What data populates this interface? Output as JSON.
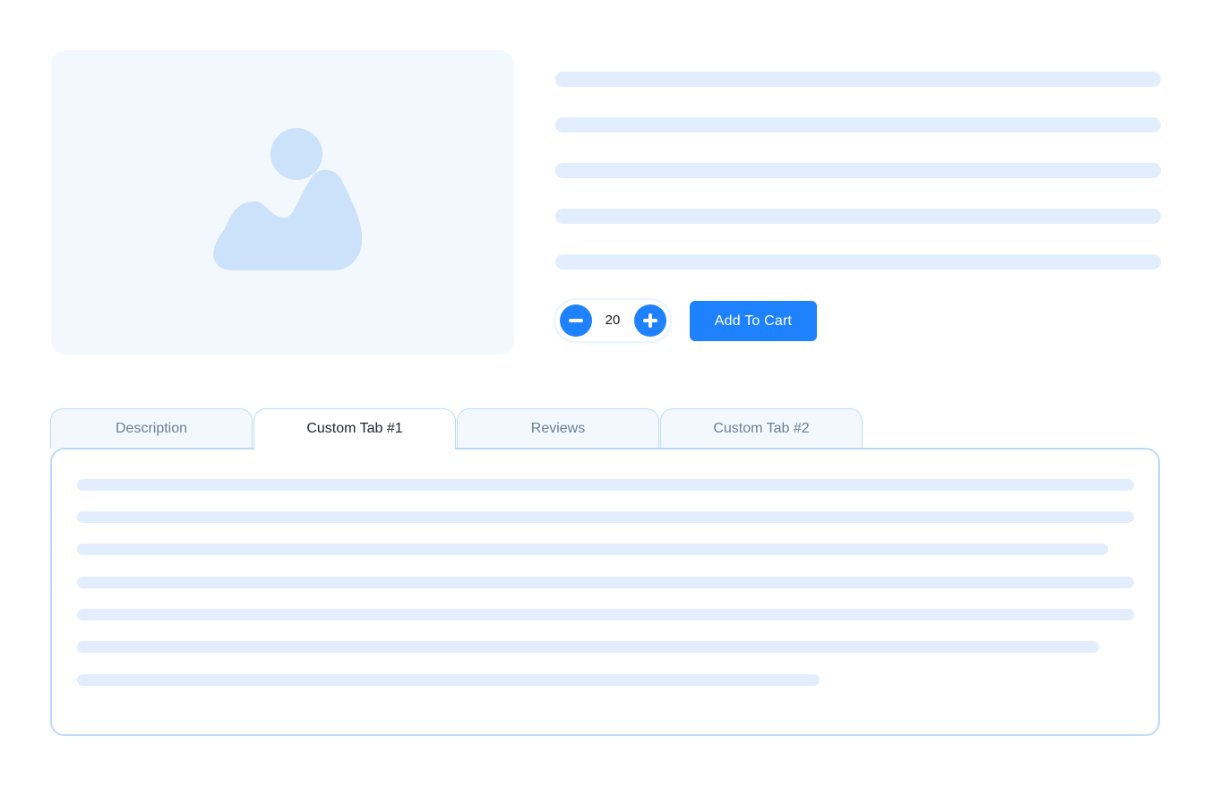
{
  "product": {
    "image_icon": "image-placeholder-icon",
    "quantity": {
      "value": "20",
      "decrement_icon": "minus-icon",
      "increment_icon": "plus-icon"
    },
    "add_to_cart_label": "Add To Cart"
  },
  "tabs": {
    "items": [
      {
        "label": "Description",
        "active": false
      },
      {
        "label": "Custom Tab #1",
        "active": true
      },
      {
        "label": "Reviews",
        "active": false
      },
      {
        "label": "Custom Tab #2",
        "active": false
      }
    ]
  },
  "colors": {
    "accent": "#1e82ff",
    "skeleton": "#e2eefd",
    "placeholder_bg": "#f3f8ff",
    "placeholder_icon": "#cce2fb",
    "border": "#bcdbfa"
  }
}
